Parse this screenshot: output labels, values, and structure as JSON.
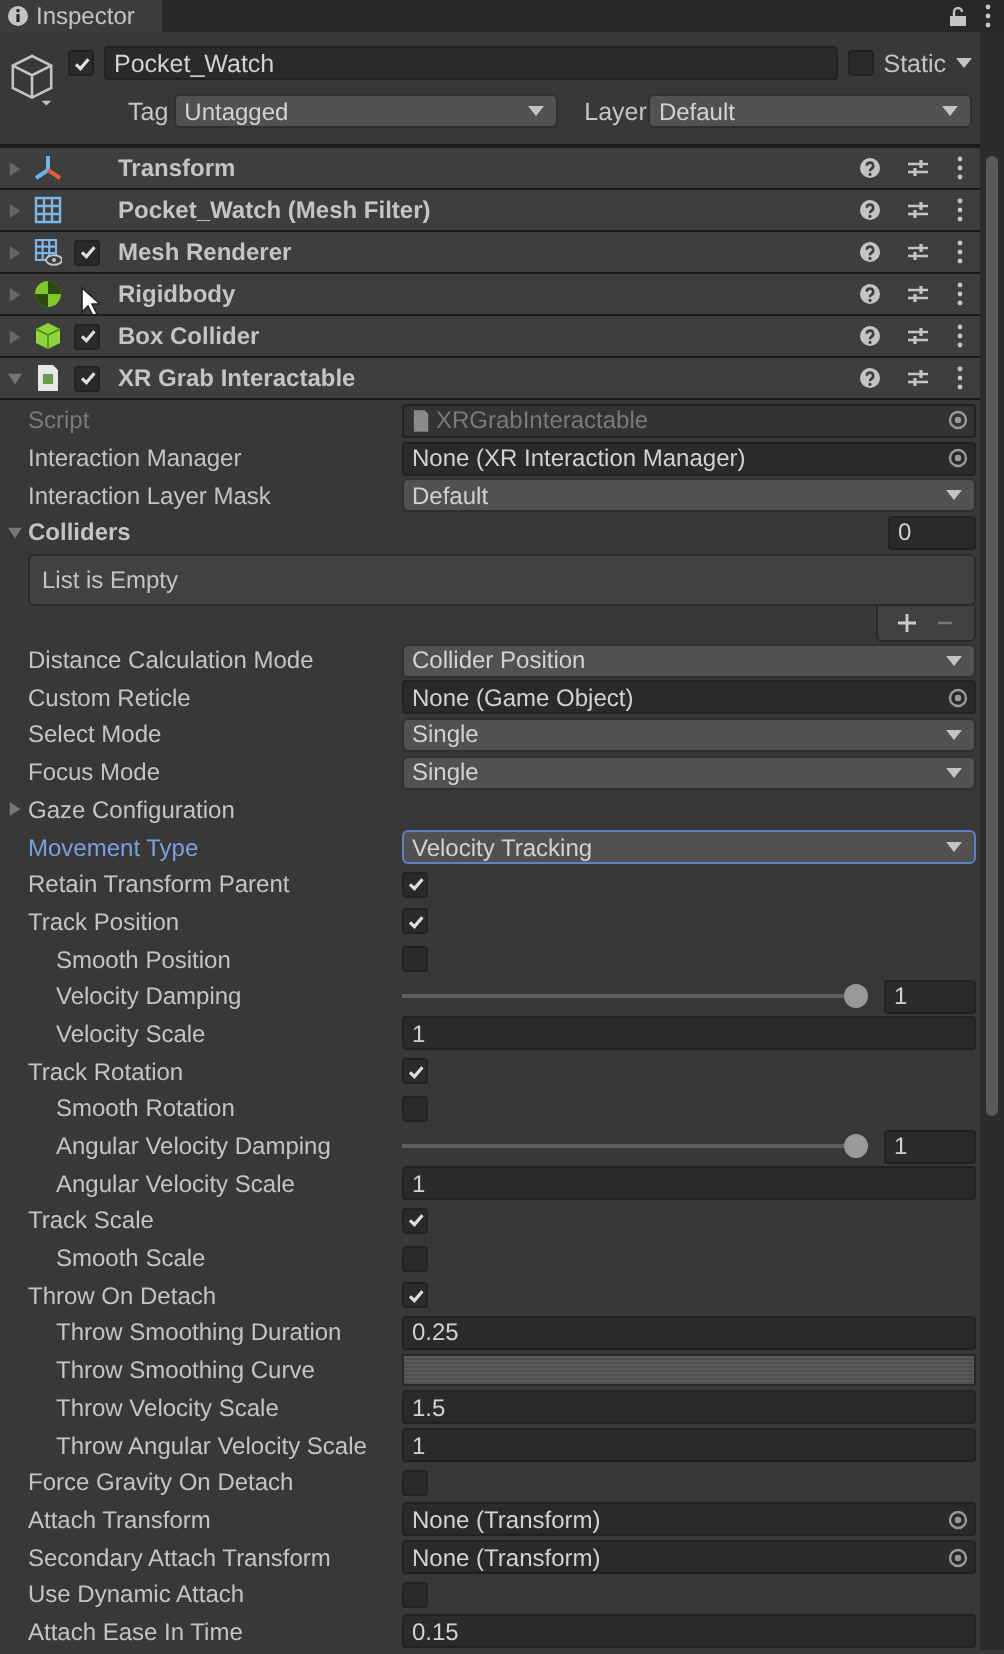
{
  "tab": {
    "title": "Inspector"
  },
  "object": {
    "active": true,
    "name": "Pocket_Watch",
    "static_label": "Static",
    "static": false,
    "tag_label": "Tag",
    "tag": "Untagged",
    "layer_label": "Layer",
    "layer": "Default"
  },
  "components": [
    {
      "kind": "transform",
      "title": "Transform",
      "expanded": false
    },
    {
      "kind": "mesh_filter",
      "title": "Pocket_Watch (Mesh Filter)",
      "expanded": false
    },
    {
      "kind": "mesh_renderer",
      "title": "Mesh Renderer",
      "enabled": true,
      "expanded": false
    },
    {
      "kind": "rigidbody",
      "title": "Rigidbody",
      "expanded": false
    },
    {
      "kind": "box_collider",
      "title": "Box Collider",
      "enabled": true,
      "expanded": false
    },
    {
      "kind": "script",
      "title": "XR Grab Interactable",
      "enabled": true,
      "expanded": true
    }
  ],
  "properties": [
    {
      "kind": "object",
      "label": "Script",
      "value": "XRGrabInteractable",
      "script": true,
      "disabled": true,
      "focused": false
    },
    {
      "kind": "object",
      "label": "Interaction Manager",
      "value": "None (XR Interaction Manager)",
      "disabled": false,
      "focused": false
    },
    {
      "kind": "dropdown",
      "label": "Interaction Layer Mask",
      "value": "Default",
      "disabled": false,
      "focused": false
    },
    {
      "kind": "array",
      "label": "Colliders",
      "size": "0",
      "expanded": true,
      "empty_text": "List is Empty",
      "disabled": false,
      "focused": false
    },
    {
      "kind": "dropdown",
      "label": "Distance Calculation Mode",
      "value": "Collider Position",
      "disabled": false,
      "focused": false
    },
    {
      "kind": "object",
      "label": "Custom Reticle",
      "value": "None (Game Object)",
      "disabled": false,
      "focused": false
    },
    {
      "kind": "dropdown",
      "label": "Select Mode",
      "value": "Single",
      "disabled": false,
      "focused": false
    },
    {
      "kind": "dropdown",
      "label": "Focus Mode",
      "value": "Single",
      "disabled": false,
      "focused": false
    },
    {
      "kind": "foldout",
      "label": "Gaze Configuration",
      "expanded": false,
      "disabled": false,
      "focused": false
    },
    {
      "kind": "dropdown",
      "label": "Movement Type",
      "value": "Velocity Tracking",
      "disabled": false,
      "focused": true
    },
    {
      "kind": "checkbox",
      "label": "Retain Transform Parent",
      "checked": true,
      "disabled": false,
      "focused": false
    },
    {
      "kind": "checkbox",
      "label": "Track Position",
      "checked": true,
      "disabled": false,
      "focused": false,
      "children": [
        {
          "kind": "checkbox",
          "label": "Smooth Position",
          "checked": false,
          "disabled": false,
          "focused": false
        },
        {
          "kind": "slider",
          "label": "Velocity Damping",
          "level": 1,
          "value": "1",
          "disabled": false,
          "focused": false
        },
        {
          "kind": "number",
          "label": "Velocity Scale",
          "value": "1",
          "disabled": false,
          "focused": false
        }
      ]
    },
    {
      "kind": "checkbox",
      "label": "Track Rotation",
      "checked": true,
      "disabled": false,
      "focused": false,
      "children": [
        {
          "kind": "checkbox",
          "label": "Smooth Rotation",
          "checked": false,
          "disabled": false,
          "focused": false
        },
        {
          "kind": "slider",
          "label": "Angular Velocity Damping",
          "level": 1,
          "value": "1",
          "disabled": false,
          "focused": false
        },
        {
          "kind": "number",
          "label": "Angular Velocity Scale",
          "value": "1",
          "disabled": false,
          "focused": false
        }
      ]
    },
    {
      "kind": "checkbox",
      "label": "Track Scale",
      "checked": true,
      "disabled": false,
      "focused": false,
      "children": [
        {
          "kind": "checkbox",
          "label": "Smooth Scale",
          "checked": false,
          "disabled": false,
          "focused": false
        }
      ]
    },
    {
      "kind": "checkbox",
      "label": "Throw On Detach",
      "checked": true,
      "disabled": false,
      "focused": false,
      "children": [
        {
          "kind": "number",
          "label": "Throw Smoothing Duration",
          "value": "0.25",
          "disabled": false,
          "focused": false
        },
        {
          "kind": "curve",
          "label": "Throw Smoothing Curve",
          "disabled": false,
          "focused": false
        },
        {
          "kind": "number",
          "label": "Throw Velocity Scale",
          "value": "1.5",
          "disabled": false,
          "focused": false
        },
        {
          "kind": "number",
          "label": "Throw Angular Velocity Scale",
          "value": "1",
          "disabled": false,
          "focused": false
        }
      ]
    },
    {
      "kind": "checkbox",
      "label": "Force Gravity On Detach",
      "checked": false,
      "disabled": false,
      "focused": false
    },
    {
      "kind": "object",
      "label": "Attach Transform",
      "value": "None (Transform)",
      "disabled": false,
      "focused": false
    },
    {
      "kind": "object",
      "label": "Secondary Attach Transform",
      "value": "None (Transform)",
      "disabled": false,
      "focused": false
    },
    {
      "kind": "checkbox",
      "label": "Use Dynamic Attach",
      "checked": false,
      "disabled": false,
      "focused": false
    },
    {
      "kind": "number",
      "label": "Attach Ease In Time",
      "value": "0.15",
      "disabled": false,
      "focused": false
    }
  ]
}
